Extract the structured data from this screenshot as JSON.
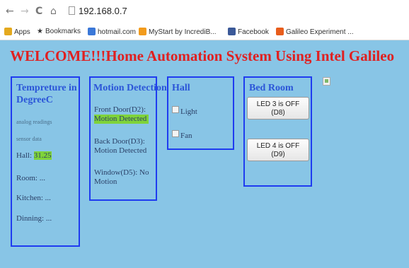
{
  "browser": {
    "url": "192.168.0.7",
    "bookmarks": [
      {
        "label": "Apps",
        "icon": "apps-grid-icon",
        "color": "#e4a91e"
      },
      {
        "label": "Bookmarks",
        "icon": "star-icon",
        "color": "#444444"
      },
      {
        "label": "hotmail.com",
        "icon": "hotmail-icon",
        "color": "#3b78d8"
      },
      {
        "label": "MyStart by IncrediB...",
        "icon": "mystart-icon",
        "color": "#f29b1c"
      },
      {
        "label": "Facebook",
        "icon": "facebook-icon",
        "color": "#3b5998"
      },
      {
        "label": "Galileo Experiment ...",
        "icon": "galileo-icon",
        "color": "#e85d1c"
      }
    ]
  },
  "page": {
    "title": "WELCOME!!!Home Automation System Using Intel Galileo",
    "temperature": {
      "title": "Tempreture in DegreeC",
      "analog_label": "analog readings",
      "sensor_label": "sensor data",
      "hall_label": "Hall:",
      "hall_value": "31.25",
      "room": "Room: ...",
      "kitchen": "Kitchen: ...",
      "dining": "Dinning: ..."
    },
    "motion": {
      "title": "Motion Detection",
      "front_label": "Front Door(D2):",
      "front_value": "Motion Detected",
      "back_label": "Back Door(D3):",
      "back_value": "Motion Detected",
      "window_label": "Window(D5): No",
      "window_value": "Motion"
    },
    "hall": {
      "title": "Hall",
      "light": "Light",
      "fan": "Fan"
    },
    "bedroom": {
      "title": "Bed Room",
      "led3_line1": "LED 3 is OFF",
      "led3_line2": "(D8)",
      "led4_line1": "LED 4 is OFF",
      "led4_line2": "(D9)"
    }
  },
  "colors": {
    "page_bg": "#88c5e6",
    "title_red": "#e02020",
    "panel_border": "#1f3cf0",
    "highlight": "#7fd33a"
  }
}
